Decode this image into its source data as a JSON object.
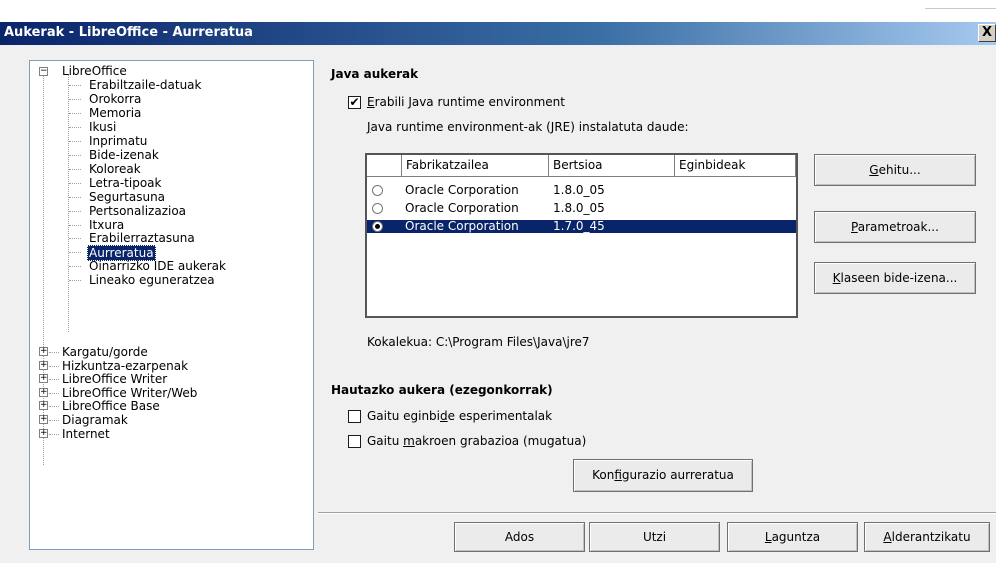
{
  "window": {
    "title": "Aukerak - LibreOffice - Aurreratua",
    "close_label": "X"
  },
  "tree": {
    "root": "LibreOffice",
    "root_expander": "−",
    "children": [
      "Erabiltzaile-datuak",
      "Orokorra",
      "Memoria",
      "Ikusi",
      "Inprimatu",
      "Bide-izenak",
      "Koloreak",
      "Letra-tipoak",
      "Segurtasuna",
      "Pertsonalizazioa",
      "Itxura",
      "Erabilerraztasuna",
      "Aurreratua",
      "Oinarrizko IDE aukerak",
      "Lineako eguneratzea"
    ],
    "selected_index": 12,
    "groups_expander": "+",
    "groups": [
      "Kargatu/gorde",
      "Hizkuntza-ezarpenak",
      "LibreOffice Writer",
      "LibreOffice Writer/Web",
      "LibreOffice Base",
      "Diagramak",
      "Internet"
    ]
  },
  "java": {
    "heading": "Java aukerak",
    "use_jre": {
      "mnemonic": "E",
      "rest": "rabili Java runtime environment",
      "checked": true,
      "mark": "✔"
    },
    "installed_label": {
      "mnemonic": "J",
      "rest": "ava runtime environment-ak (JRE) instalatuta daude:"
    },
    "table": {
      "columns": [
        "Fabrikatzailea",
        "Bertsioa",
        "Eginbideak"
      ],
      "rows": [
        {
          "vendor": "Oracle Corporation",
          "version": "1.8.0_05",
          "features": "",
          "selected": false
        },
        {
          "vendor": "Oracle Corporation",
          "version": "1.8.0_05",
          "features": "",
          "selected": false
        },
        {
          "vendor": "Oracle Corporation",
          "version": "1.7.0_45",
          "features": "",
          "selected": true
        }
      ]
    },
    "location": "Kokalekua: C:\\Program Files\\Java\\jre7",
    "buttons": {
      "add": {
        "mnemonic": "G",
        "rest": "ehitu..."
      },
      "params": {
        "mnemonic": "P",
        "rest": "arametroak..."
      },
      "classpath": {
        "mnemonic": "K",
        "rest": "laseen bide-izena..."
      }
    }
  },
  "optional": {
    "heading": "Hautazko aukera (ezegonkorrak)",
    "experimental": {
      "pre": "Gaitu eginbi",
      "mnemonic": "d",
      "post": "e esperimentalak",
      "checked": false
    },
    "macro": {
      "pre": "Gaitu ",
      "mnemonic": "m",
      "post": "akroen grabazioa (mugatua)",
      "checked": false
    },
    "expert_config": {
      "pre": "Kon",
      "mnemonic": "f",
      "post": "igurazio aurreratua"
    }
  },
  "footer": {
    "ok": "Ados",
    "cancel": "Utzi",
    "help": {
      "mnemonic": "L",
      "rest": "aguntza"
    },
    "reset": {
      "mnemonic": "A",
      "rest": "lderantzikatu"
    }
  }
}
